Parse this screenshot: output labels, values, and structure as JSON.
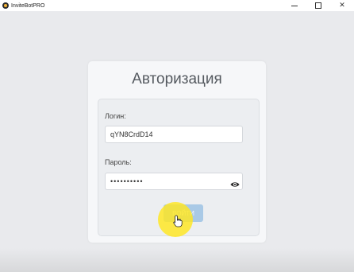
{
  "window": {
    "title": "InviteBotPRO",
    "icon": "app-logo-icon",
    "controls": [
      "minimize-icon",
      "maximize-icon",
      "close-icon"
    ]
  },
  "login_form": {
    "title": "Авторизация",
    "login_label": "Логин:",
    "login_value": "qYN8CrdD14",
    "password_label": "Пароль:",
    "password_value": "••••••••••",
    "show_password_icon": "eye-icon",
    "submit_label": "ВОЙТИ"
  },
  "overlay": {
    "click_highlight_color": "#FFE61E",
    "cursor_icon": "hand-pointer-icon"
  }
}
